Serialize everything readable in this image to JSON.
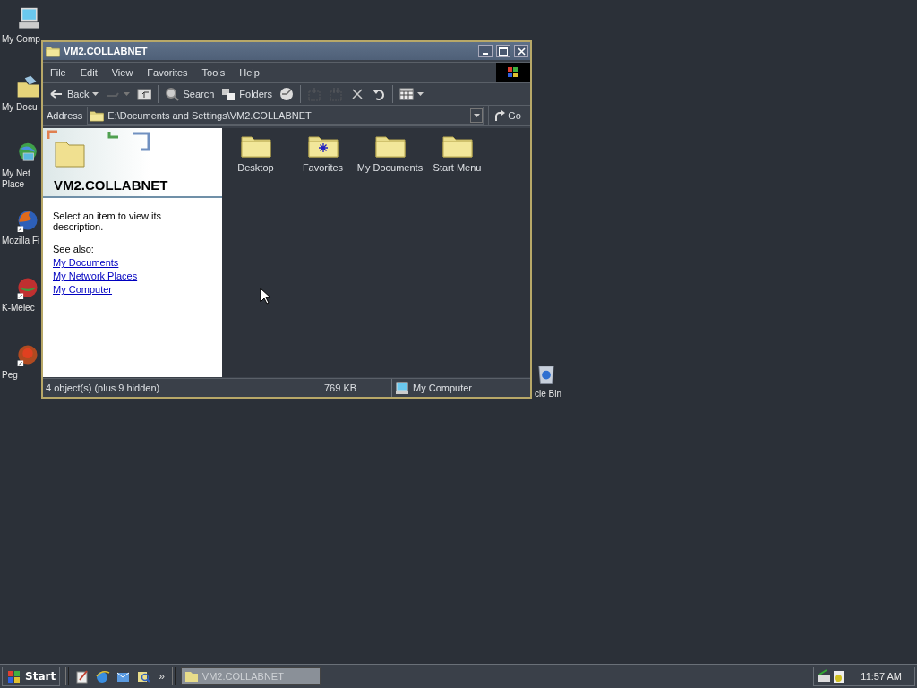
{
  "desktop_icons": [
    {
      "kind": "computer",
      "lines": [
        "My Comp"
      ]
    },
    {
      "kind": "documents",
      "lines": [
        "My Docu"
      ]
    },
    {
      "kind": "network",
      "lines": [
        "My Net",
        "Place"
      ]
    },
    {
      "kind": "browser",
      "lines": [
        "Mozilla Fi"
      ]
    },
    {
      "kind": "melon",
      "lines": [
        "K-Melec"
      ]
    },
    {
      "kind": "ball",
      "lines": [
        "Peg"
      ]
    },
    {
      "kind": "bin",
      "lines": [
        "cle Bin"
      ]
    }
  ],
  "window": {
    "title": "VM2.COLLABNET",
    "menu": [
      "File",
      "Edit",
      "View",
      "Favorites",
      "Tools",
      "Help"
    ],
    "toolbar": [
      {
        "kind": "back",
        "label": "Back",
        "disabled": false
      },
      {
        "kind": "forward",
        "disabled": true
      },
      {
        "kind": "up",
        "disabled": false
      },
      {
        "kind": "search",
        "label": "Search",
        "disabled": false
      },
      {
        "kind": "folders",
        "label": "Folders",
        "disabled": false
      },
      {
        "kind": "history",
        "disabled": false
      },
      {
        "kind": "move",
        "disabled": true
      },
      {
        "kind": "copy",
        "disabled": true
      },
      {
        "kind": "delete",
        "disabled": false
      },
      {
        "kind": "undo",
        "disabled": false
      },
      {
        "kind": "views",
        "disabled": false
      }
    ],
    "address": {
      "label": "Address",
      "value": "E:\\Documents and Settings\\VM2.COLLABNET",
      "go": "Go"
    },
    "task_pane": {
      "title": "VM2.COLLABNET",
      "description": "Select an item to view its description.",
      "see_also": "See also:",
      "links": [
        "My Documents",
        "My Network Places",
        "My Computer"
      ]
    },
    "items": [
      {
        "kind": "folder",
        "label": "Desktop"
      },
      {
        "kind": "favorites",
        "label": "Favorites"
      },
      {
        "kind": "folder",
        "label": "My Documents"
      },
      {
        "kind": "folder",
        "label": "Start Menu"
      }
    ],
    "status_bar": {
      "objects": "4 object(s) (plus 9 hidden)",
      "size": "769 KB",
      "zone": "My Computer"
    }
  },
  "taskbar": {
    "start": "Start",
    "quick_launch": [
      {
        "kind": "notepad"
      },
      {
        "kind": "browser"
      },
      {
        "kind": "mail"
      },
      {
        "kind": "find"
      }
    ],
    "more": "»",
    "tasks": [
      {
        "label": "VM2.COLLABNET",
        "selected": true
      }
    ],
    "clock": "11:57 AM"
  }
}
